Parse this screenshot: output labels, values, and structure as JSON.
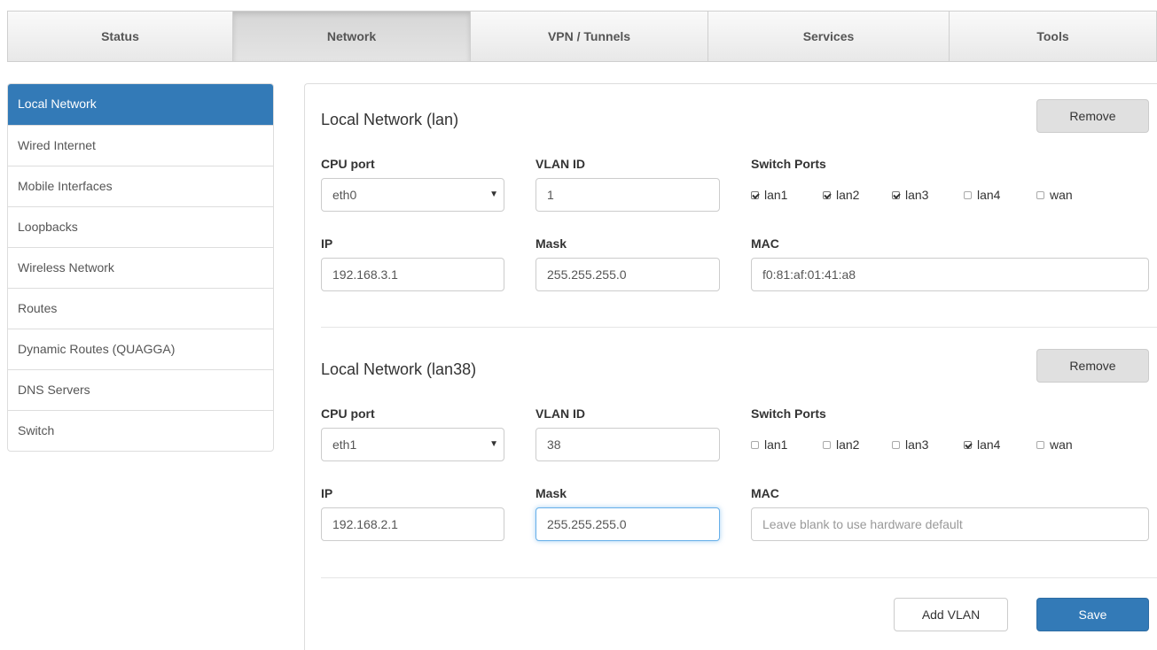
{
  "topnav": {
    "tabs": [
      {
        "label": "Status"
      },
      {
        "label": "Network"
      },
      {
        "label": "VPN / Tunnels"
      },
      {
        "label": "Services"
      },
      {
        "label": "Tools"
      }
    ]
  },
  "sidebar": {
    "items": [
      {
        "label": "Local Network"
      },
      {
        "label": "Wired Internet"
      },
      {
        "label": "Mobile Interfaces"
      },
      {
        "label": "Loopbacks"
      },
      {
        "label": "Wireless Network"
      },
      {
        "label": "Routes"
      },
      {
        "label": "Dynamic Routes (QUAGGA)"
      },
      {
        "label": "DNS Servers"
      },
      {
        "label": "Switch"
      }
    ]
  },
  "labels": {
    "cpu_port": "CPU port",
    "vlan_id": "VLAN ID",
    "switch_ports": "Switch Ports",
    "ip": "IP",
    "mask": "Mask",
    "mac": "MAC"
  },
  "networks": [
    {
      "title": "Local Network (lan)",
      "remove_label": "Remove",
      "cpu_port": "eth0",
      "vlan_id": "1",
      "ports": [
        {
          "name": "lan1",
          "checked": true
        },
        {
          "name": "lan2",
          "checked": true
        },
        {
          "name": "lan3",
          "checked": true
        },
        {
          "name": "lan4",
          "checked": false
        },
        {
          "name": "wan",
          "checked": false
        }
      ],
      "ip": "192.168.3.1",
      "mask": "255.255.255.0",
      "mac": "f0:81:af:01:41:a8"
    },
    {
      "title": "Local Network (lan38)",
      "remove_label": "Remove",
      "cpu_port": "eth1",
      "vlan_id": "38",
      "ports": [
        {
          "name": "lan1",
          "checked": false
        },
        {
          "name": "lan2",
          "checked": false
        },
        {
          "name": "lan3",
          "checked": false
        },
        {
          "name": "lan4",
          "checked": true
        },
        {
          "name": "wan",
          "checked": false
        }
      ],
      "ip": "192.168.2.1",
      "mask": "255.255.255.0",
      "mac_placeholder": "Leave blank to use hardware default"
    }
  ],
  "footer": {
    "add_vlan_label": "Add VLAN",
    "save_label": "Save"
  },
  "colors": {
    "accent": "#337ab7",
    "active_sidebar_text": "#ffffff"
  }
}
